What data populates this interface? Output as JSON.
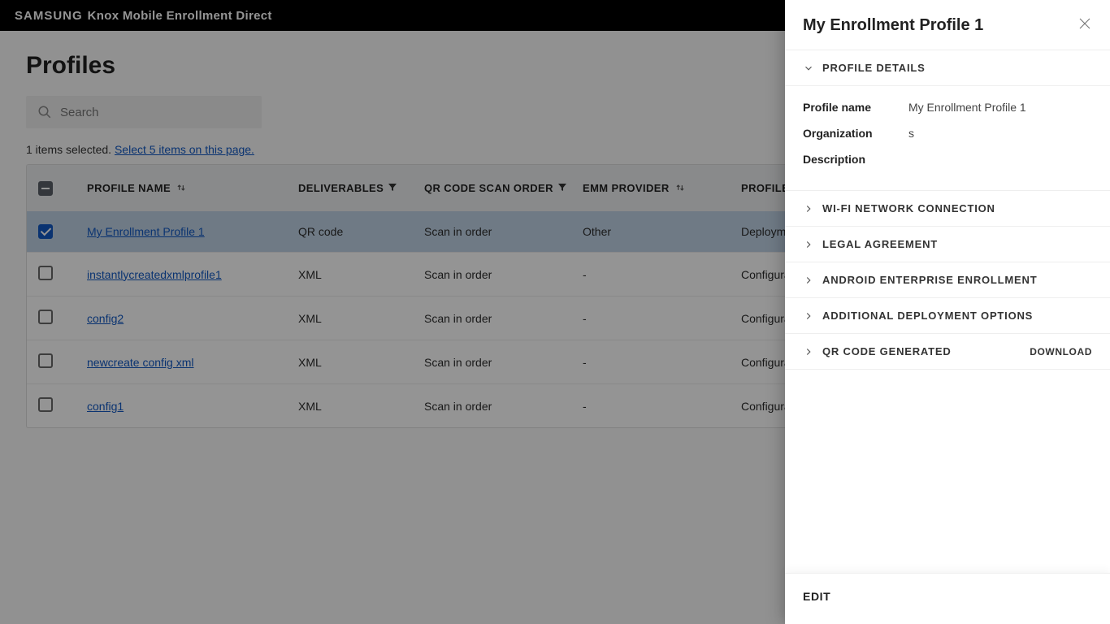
{
  "header": {
    "brand": "SAMSUNG",
    "product": "Knox Mobile Enrollment Direct"
  },
  "page": {
    "title": "Profiles",
    "search_placeholder": "Search",
    "selection_text": "1 items selected.",
    "select_all_link": "Select 5 items on this page."
  },
  "columns": {
    "name": "Profile Name",
    "deliverables": "Deliverables",
    "qr": "QR Code Scan Order",
    "emm": "EMM Provider",
    "ptype": "Profile Type"
  },
  "rows": [
    {
      "selected": true,
      "name": "My Enrollment Profile 1",
      "deliv": "QR code",
      "qr": "Scan in order",
      "emm": "Other",
      "ptype": "Deployment"
    },
    {
      "selected": false,
      "name": "instantlycreatedxmlprofile1",
      "deliv": "XML",
      "qr": "Scan in order",
      "emm": "-",
      "ptype": "Configuration"
    },
    {
      "selected": false,
      "name": "config2",
      "deliv": "XML",
      "qr": "Scan in order",
      "emm": "-",
      "ptype": "Configuration"
    },
    {
      "selected": false,
      "name": "newcreate config xml",
      "deliv": "XML",
      "qr": "Scan in order",
      "emm": "-",
      "ptype": "Configuration"
    },
    {
      "selected": false,
      "name": "config1",
      "deliv": "XML",
      "qr": "Scan in order",
      "emm": "-",
      "ptype": "Configuration"
    }
  ],
  "panel": {
    "title": "My Enrollment Profile 1",
    "sections": {
      "details": "Profile Details",
      "wifi": "Wi-Fi Network Connection",
      "legal": "Legal Agreement",
      "ae": "Android Enterprise Enrollment",
      "addl": "Additional Deployment Options",
      "qr": "QR Code Generated",
      "qr_action": "Download"
    },
    "details": {
      "profile_name_label": "Profile name",
      "profile_name_value": "My Enrollment Profile 1",
      "org_label": "Organization",
      "org_value": "s",
      "desc_label": "Description",
      "desc_value": ""
    },
    "footer": {
      "edit": "EDIT"
    }
  }
}
